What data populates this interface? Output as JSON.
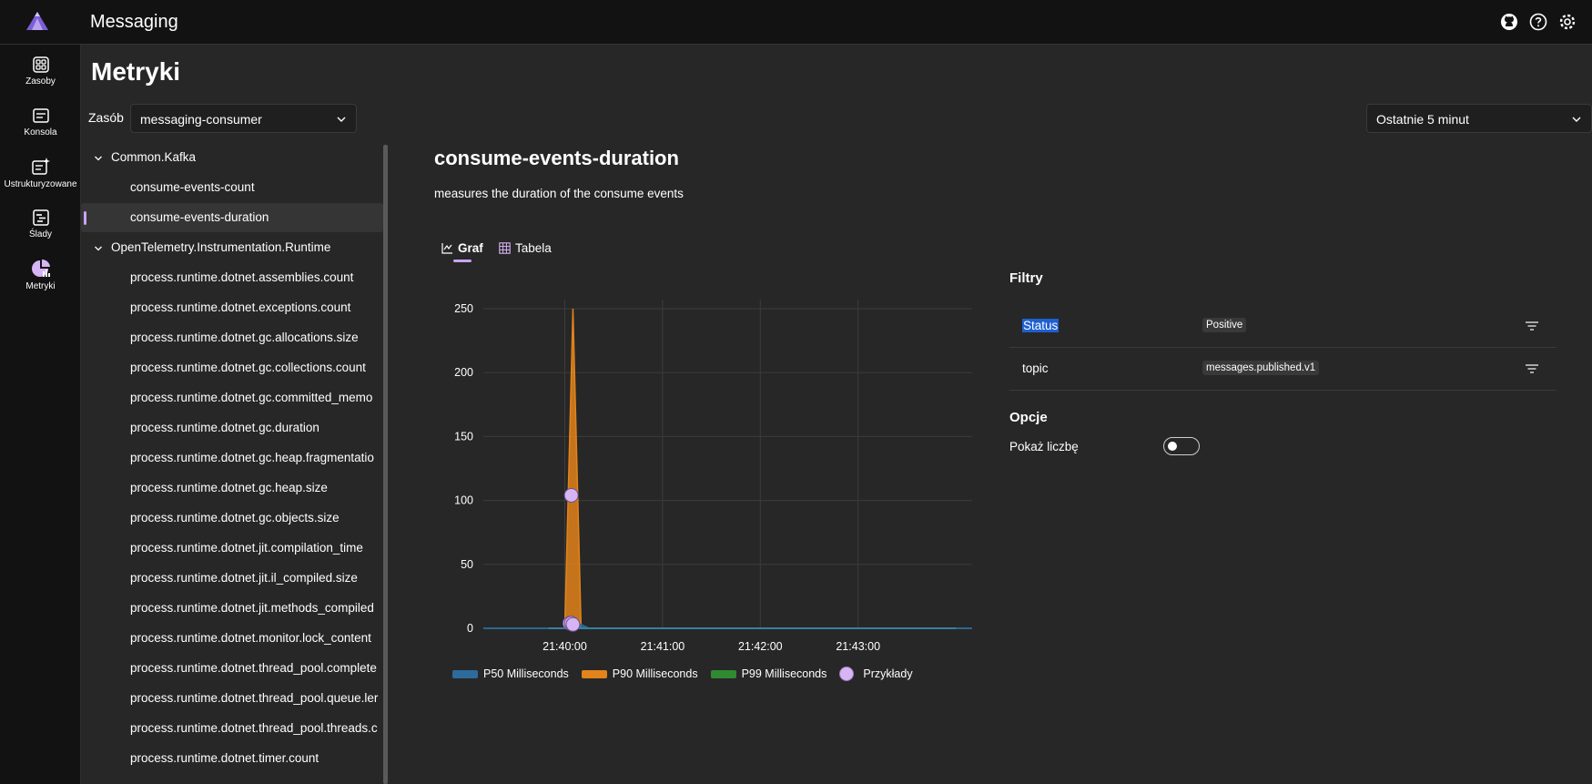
{
  "header": {
    "app_title": "Messaging",
    "icons": [
      "github-icon",
      "help-icon",
      "settings-icon"
    ]
  },
  "nav": {
    "items": [
      {
        "label": "Zasoby",
        "icon": "resources-icon"
      },
      {
        "label": "Konsola",
        "icon": "console-icon"
      },
      {
        "label": "Ustrukturyzowane",
        "icon": "structured-icon"
      },
      {
        "label": "Ślady",
        "icon": "traces-icon"
      },
      {
        "label": "Metryki",
        "icon": "metrics-icon"
      }
    ]
  },
  "page": {
    "title": "Metryki",
    "resource_label": "Zasób",
    "resource_value": "messaging-consumer",
    "time_range_value": "Ostatnie 5 minut"
  },
  "tree": {
    "groups": [
      {
        "name": "Common.Kafka",
        "items": [
          "consume-events-count",
          "consume-events-duration"
        ]
      },
      {
        "name": "OpenTelemetry.Instrumentation.Runtime",
        "items": [
          "process.runtime.dotnet.assemblies.count",
          "process.runtime.dotnet.exceptions.count",
          "process.runtime.dotnet.gc.allocations.size",
          "process.runtime.dotnet.gc.collections.count",
          "process.runtime.dotnet.gc.committed_memo",
          "process.runtime.dotnet.gc.duration",
          "process.runtime.dotnet.gc.heap.fragmentatio",
          "process.runtime.dotnet.gc.heap.size",
          "process.runtime.dotnet.gc.objects.size",
          "process.runtime.dotnet.jit.compilation_time",
          "process.runtime.dotnet.jit.il_compiled.size",
          "process.runtime.dotnet.jit.methods_compiled",
          "process.runtime.dotnet.monitor.lock_content",
          "process.runtime.dotnet.thread_pool.complete",
          "process.runtime.dotnet.thread_pool.queue.ler",
          "process.runtime.dotnet.thread_pool.threads.c",
          "process.runtime.dotnet.timer.count"
        ]
      }
    ],
    "selected": "consume-events-duration"
  },
  "detail": {
    "title": "consume-events-duration",
    "description": "measures the duration of the consume events",
    "tabs": [
      "Graf",
      "Tabela"
    ],
    "active_tab": "Graf"
  },
  "chart_data": {
    "type": "area",
    "x": [
      "21:39:50",
      "21:39:55",
      "21:40:00",
      "21:40:05",
      "21:40:10",
      "21:40:15",
      "21:40:20",
      "21:44:00"
    ],
    "x_ticks": [
      "21:40:00",
      "21:41:00",
      "21:42:00",
      "21:43:00"
    ],
    "y_ticks": [
      "0",
      "50",
      "100",
      "150",
      "200",
      "250"
    ],
    "ylim": [
      0,
      250
    ],
    "grid": true,
    "series": [
      {
        "name": "P50 Milliseconds",
        "color": "#2d6b9c",
        "values": [
          0,
          0,
          0,
          4,
          3,
          0,
          0,
          0
        ]
      },
      {
        "name": "P90 Milliseconds",
        "color": "#e2831b",
        "values": [
          0,
          0,
          0,
          250,
          0,
          0,
          0,
          0
        ]
      },
      {
        "name": "P99 Milliseconds",
        "color": "#2f8a32",
        "values": [
          0,
          0,
          0,
          0,
          0,
          0,
          0,
          0
        ]
      }
    ],
    "exemplars_label": "Przykłady",
    "exemplars": [
      {
        "x": "21:40:04",
        "y": 104
      },
      {
        "x": "21:40:03",
        "y": 4
      },
      {
        "x": "21:40:04",
        "y": 4
      },
      {
        "x": "21:40:05",
        "y": 3
      }
    ],
    "legend_position": "bottom"
  },
  "filters": {
    "title": "Filtry",
    "rows": [
      {
        "name": "Status",
        "value": "Positive"
      },
      {
        "name": "topic",
        "value": "messages.published.v1"
      }
    ]
  },
  "options": {
    "title": "Opcje",
    "show_count_label": "Pokaż liczbę",
    "show_count": false
  }
}
